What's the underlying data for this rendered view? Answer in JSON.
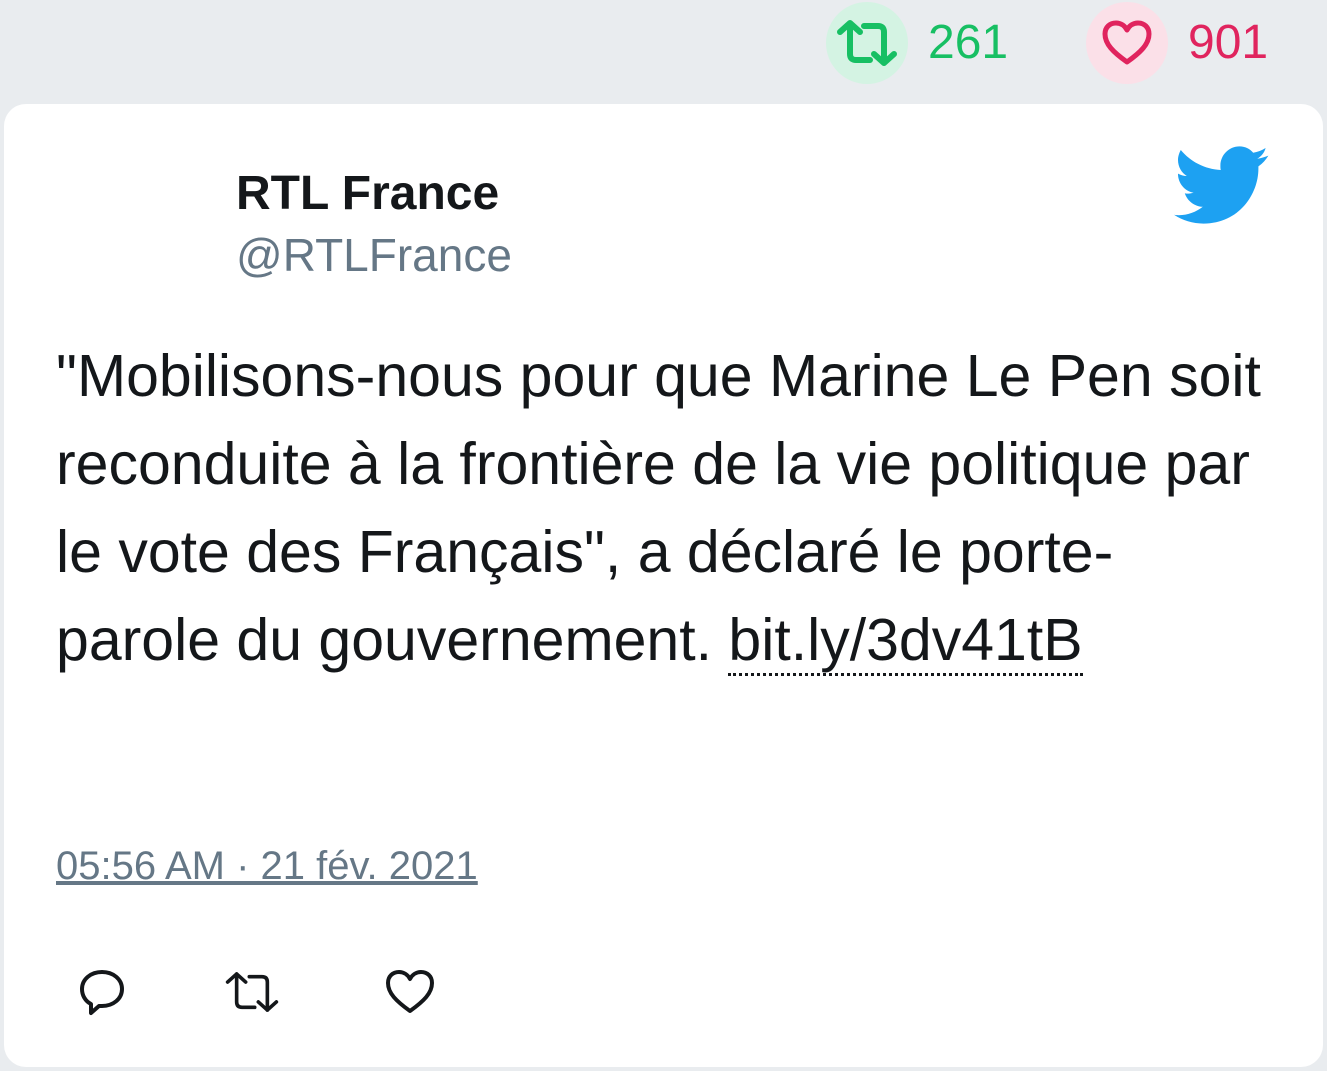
{
  "top_stats": {
    "retweets": "261",
    "likes": "901",
    "retweet_color": "#17bf63",
    "like_color": "#e0245e"
  },
  "tweet": {
    "author_name": "RTL France",
    "author_handle": "@RTLFrance",
    "text": "\"Mobilisons-nous pour que Marine Le Pen soit reconduite à la frontière de la vie politique par le vote des Français\", a déclaré le porte-parole du gouvernement. ",
    "link_text": "bit.ly/3dv41tB",
    "timestamp": "05:56 AM · 21 fév. 2021"
  },
  "icons": {
    "brand": "twitter-bird-icon",
    "actions": [
      "reply-icon",
      "retweet-icon",
      "like-icon"
    ]
  },
  "colors": {
    "twitter_blue": "#1da1f2",
    "secondary_text": "#657786"
  }
}
